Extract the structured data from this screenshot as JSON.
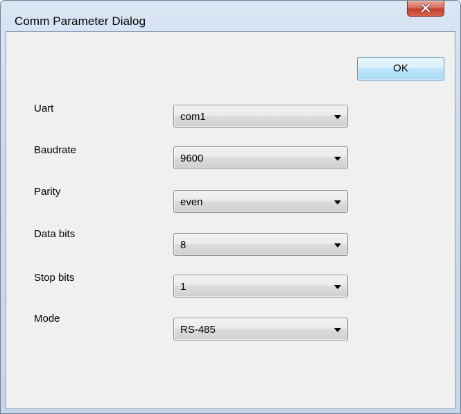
{
  "window": {
    "title": "Comm Parameter Dialog",
    "close_icon": "close-icon"
  },
  "buttons": {
    "ok_label": "OK"
  },
  "fields": [
    {
      "label": "Uart",
      "value": "com1"
    },
    {
      "label": "Baudrate",
      "value": "9600"
    },
    {
      "label": "Parity",
      "value": "even"
    },
    {
      "label": "Data bits",
      "value": "8"
    },
    {
      "label": "Stop bits",
      "value": "1"
    },
    {
      "label": "Mode",
      "value": "RS-485"
    }
  ],
  "colors": {
    "frame": "#c7d6ea",
    "close_button": "#c4402c",
    "ok_border": "#3c7fb1",
    "dialog_bg": "#f0f0f0"
  }
}
